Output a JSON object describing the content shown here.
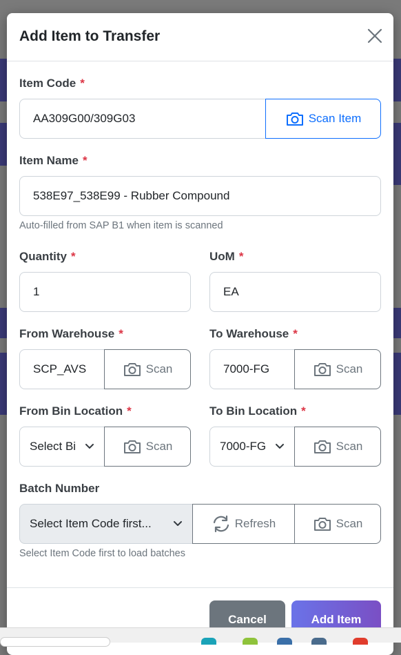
{
  "modal": {
    "title": "Add Item to Transfer",
    "close_icon": "close-icon"
  },
  "item_code": {
    "label": "Item Code",
    "required_mark": "*",
    "value": "AA309G00/309G03",
    "scan_button": "Scan Item"
  },
  "item_name": {
    "label": "Item Name",
    "required_mark": "*",
    "value": "538E97_538E99 - Rubber Compound",
    "help": "Auto-filled from SAP B1 when item is scanned"
  },
  "quantity": {
    "label": "Quantity",
    "required_mark": "*",
    "value": "1"
  },
  "uom": {
    "label": "UoM",
    "required_mark": "*",
    "value": "EA"
  },
  "from_warehouse": {
    "label": "From Warehouse",
    "required_mark": "*",
    "value": "SCP_AVS",
    "scan_button": "Scan"
  },
  "to_warehouse": {
    "label": "To Warehouse",
    "required_mark": "*",
    "value": "7000-FG",
    "scan_button": "Scan"
  },
  "from_bin": {
    "label": "From Bin Location",
    "required_mark": "*",
    "selected": "Select Bi",
    "scan_button": "Scan"
  },
  "to_bin": {
    "label": "To Bin Location",
    "required_mark": "*",
    "selected": "7000-FG",
    "scan_button": "Scan"
  },
  "batch": {
    "label": "Batch Number",
    "selected": "Select Item Code first...",
    "refresh_button": "Refresh",
    "scan_button": "Scan",
    "help": "Select Item Code first to load batches"
  },
  "footer": {
    "cancel_button": "Cancel",
    "add_button": "Add Item"
  },
  "colors": {
    "primary": "#0d6efd",
    "required": "#dc3545",
    "cancel_bg": "#6c757d",
    "add_gradient_start": "#6a73e8",
    "add_gradient_end": "#7a4fc4"
  }
}
